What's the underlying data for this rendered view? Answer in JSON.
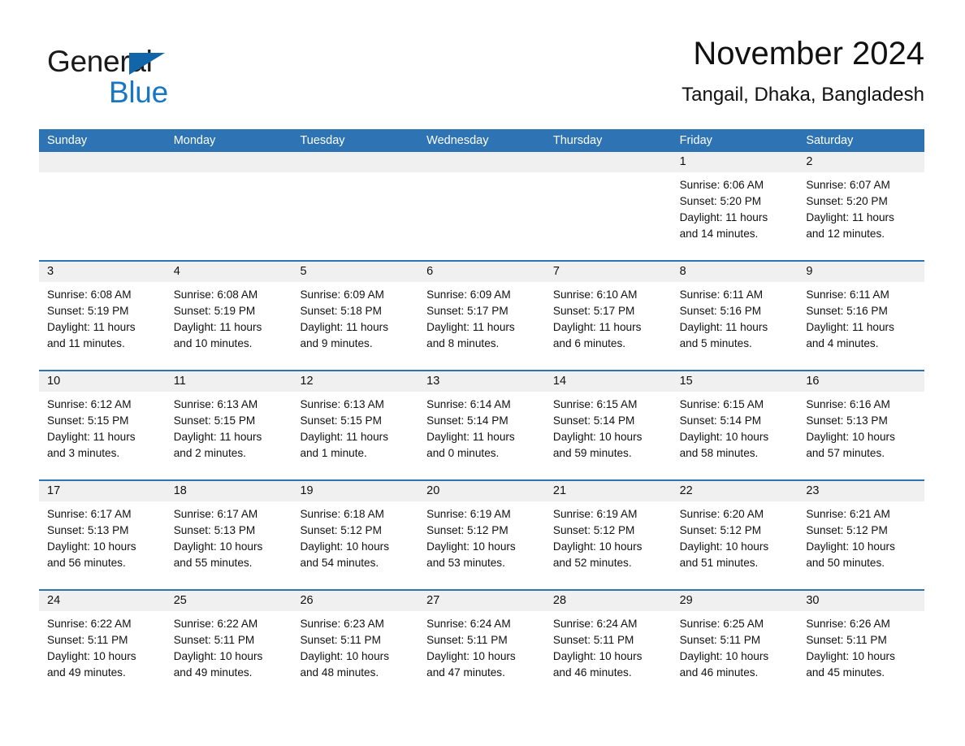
{
  "brand": {
    "word1": "General",
    "word2": "Blue",
    "triangle_color": "#1165a8",
    "blue_color": "#1877c4"
  },
  "header": {
    "title": "November 2024",
    "subtitle": "Tangail, Dhaka, Bangladesh"
  },
  "theme": {
    "header_blue": "#2e74b5",
    "day_band_gray": "#f0f0f0",
    "text_color": "#111111"
  },
  "weekdays": [
    "Sunday",
    "Monday",
    "Tuesday",
    "Wednesday",
    "Thursday",
    "Friday",
    "Saturday"
  ],
  "weeks": [
    [
      {
        "day": "",
        "empty": true
      },
      {
        "day": "",
        "empty": true
      },
      {
        "day": "",
        "empty": true
      },
      {
        "day": "",
        "empty": true
      },
      {
        "day": "",
        "empty": true
      },
      {
        "day": "1",
        "sunrise": "Sunrise: 6:06 AM",
        "sunset": "Sunset: 5:20 PM",
        "daylight1": "Daylight: 11 hours",
        "daylight2": "and 14 minutes."
      },
      {
        "day": "2",
        "sunrise": "Sunrise: 6:07 AM",
        "sunset": "Sunset: 5:20 PM",
        "daylight1": "Daylight: 11 hours",
        "daylight2": "and 12 minutes."
      }
    ],
    [
      {
        "day": "3",
        "sunrise": "Sunrise: 6:08 AM",
        "sunset": "Sunset: 5:19 PM",
        "daylight1": "Daylight: 11 hours",
        "daylight2": "and 11 minutes."
      },
      {
        "day": "4",
        "sunrise": "Sunrise: 6:08 AM",
        "sunset": "Sunset: 5:19 PM",
        "daylight1": "Daylight: 11 hours",
        "daylight2": "and 10 minutes."
      },
      {
        "day": "5",
        "sunrise": "Sunrise: 6:09 AM",
        "sunset": "Sunset: 5:18 PM",
        "daylight1": "Daylight: 11 hours",
        "daylight2": "and 9 minutes."
      },
      {
        "day": "6",
        "sunrise": "Sunrise: 6:09 AM",
        "sunset": "Sunset: 5:17 PM",
        "daylight1": "Daylight: 11 hours",
        "daylight2": "and 8 minutes."
      },
      {
        "day": "7",
        "sunrise": "Sunrise: 6:10 AM",
        "sunset": "Sunset: 5:17 PM",
        "daylight1": "Daylight: 11 hours",
        "daylight2": "and 6 minutes."
      },
      {
        "day": "8",
        "sunrise": "Sunrise: 6:11 AM",
        "sunset": "Sunset: 5:16 PM",
        "daylight1": "Daylight: 11 hours",
        "daylight2": "and 5 minutes."
      },
      {
        "day": "9",
        "sunrise": "Sunrise: 6:11 AM",
        "sunset": "Sunset: 5:16 PM",
        "daylight1": "Daylight: 11 hours",
        "daylight2": "and 4 minutes."
      }
    ],
    [
      {
        "day": "10",
        "sunrise": "Sunrise: 6:12 AM",
        "sunset": "Sunset: 5:15 PM",
        "daylight1": "Daylight: 11 hours",
        "daylight2": "and 3 minutes."
      },
      {
        "day": "11",
        "sunrise": "Sunrise: 6:13 AM",
        "sunset": "Sunset: 5:15 PM",
        "daylight1": "Daylight: 11 hours",
        "daylight2": "and 2 minutes."
      },
      {
        "day": "12",
        "sunrise": "Sunrise: 6:13 AM",
        "sunset": "Sunset: 5:15 PM",
        "daylight1": "Daylight: 11 hours",
        "daylight2": "and 1 minute."
      },
      {
        "day": "13",
        "sunrise": "Sunrise: 6:14 AM",
        "sunset": "Sunset: 5:14 PM",
        "daylight1": "Daylight: 11 hours",
        "daylight2": "and 0 minutes."
      },
      {
        "day": "14",
        "sunrise": "Sunrise: 6:15 AM",
        "sunset": "Sunset: 5:14 PM",
        "daylight1": "Daylight: 10 hours",
        "daylight2": "and 59 minutes."
      },
      {
        "day": "15",
        "sunrise": "Sunrise: 6:15 AM",
        "sunset": "Sunset: 5:14 PM",
        "daylight1": "Daylight: 10 hours",
        "daylight2": "and 58 minutes."
      },
      {
        "day": "16",
        "sunrise": "Sunrise: 6:16 AM",
        "sunset": "Sunset: 5:13 PM",
        "daylight1": "Daylight: 10 hours",
        "daylight2": "and 57 minutes."
      }
    ],
    [
      {
        "day": "17",
        "sunrise": "Sunrise: 6:17 AM",
        "sunset": "Sunset: 5:13 PM",
        "daylight1": "Daylight: 10 hours",
        "daylight2": "and 56 minutes."
      },
      {
        "day": "18",
        "sunrise": "Sunrise: 6:17 AM",
        "sunset": "Sunset: 5:13 PM",
        "daylight1": "Daylight: 10 hours",
        "daylight2": "and 55 minutes."
      },
      {
        "day": "19",
        "sunrise": "Sunrise: 6:18 AM",
        "sunset": "Sunset: 5:12 PM",
        "daylight1": "Daylight: 10 hours",
        "daylight2": "and 54 minutes."
      },
      {
        "day": "20",
        "sunrise": "Sunrise: 6:19 AM",
        "sunset": "Sunset: 5:12 PM",
        "daylight1": "Daylight: 10 hours",
        "daylight2": "and 53 minutes."
      },
      {
        "day": "21",
        "sunrise": "Sunrise: 6:19 AM",
        "sunset": "Sunset: 5:12 PM",
        "daylight1": "Daylight: 10 hours",
        "daylight2": "and 52 minutes."
      },
      {
        "day": "22",
        "sunrise": "Sunrise: 6:20 AM",
        "sunset": "Sunset: 5:12 PM",
        "daylight1": "Daylight: 10 hours",
        "daylight2": "and 51 minutes."
      },
      {
        "day": "23",
        "sunrise": "Sunrise: 6:21 AM",
        "sunset": "Sunset: 5:12 PM",
        "daylight1": "Daylight: 10 hours",
        "daylight2": "and 50 minutes."
      }
    ],
    [
      {
        "day": "24",
        "sunrise": "Sunrise: 6:22 AM",
        "sunset": "Sunset: 5:11 PM",
        "daylight1": "Daylight: 10 hours",
        "daylight2": "and 49 minutes."
      },
      {
        "day": "25",
        "sunrise": "Sunrise: 6:22 AM",
        "sunset": "Sunset: 5:11 PM",
        "daylight1": "Daylight: 10 hours",
        "daylight2": "and 49 minutes."
      },
      {
        "day": "26",
        "sunrise": "Sunrise: 6:23 AM",
        "sunset": "Sunset: 5:11 PM",
        "daylight1": "Daylight: 10 hours",
        "daylight2": "and 48 minutes."
      },
      {
        "day": "27",
        "sunrise": "Sunrise: 6:24 AM",
        "sunset": "Sunset: 5:11 PM",
        "daylight1": "Daylight: 10 hours",
        "daylight2": "and 47 minutes."
      },
      {
        "day": "28",
        "sunrise": "Sunrise: 6:24 AM",
        "sunset": "Sunset: 5:11 PM",
        "daylight1": "Daylight: 10 hours",
        "daylight2": "and 46 minutes."
      },
      {
        "day": "29",
        "sunrise": "Sunrise: 6:25 AM",
        "sunset": "Sunset: 5:11 PM",
        "daylight1": "Daylight: 10 hours",
        "daylight2": "and 46 minutes."
      },
      {
        "day": "30",
        "sunrise": "Sunrise: 6:26 AM",
        "sunset": "Sunset: 5:11 PM",
        "daylight1": "Daylight: 10 hours",
        "daylight2": "and 45 minutes."
      }
    ]
  ]
}
